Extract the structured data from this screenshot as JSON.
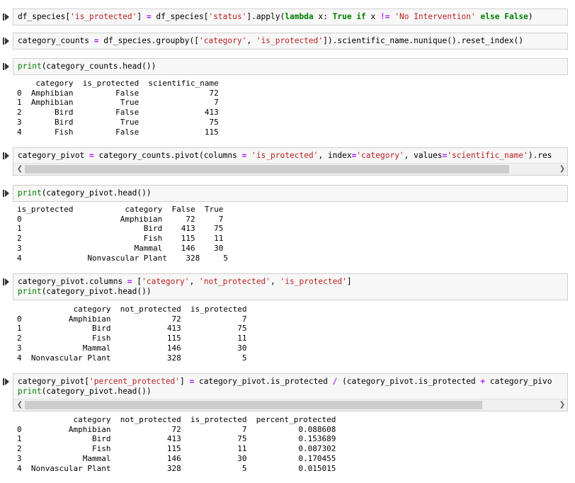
{
  "cells": [
    {
      "code": [
        [
          [
            "df_species[",
            ""
          ],
          [
            "'is_protected'",
            "str"
          ],
          [
            "] ",
            ""
          ],
          [
            "=",
            "op"
          ],
          [
            " df_species[",
            ""
          ],
          [
            "'status'",
            "str"
          ],
          [
            "].apply(",
            ""
          ],
          [
            "lambda",
            "kw"
          ],
          [
            " x: ",
            ""
          ],
          [
            "True",
            "kw"
          ],
          [
            " ",
            ""
          ],
          [
            "if",
            "kw"
          ],
          [
            " x ",
            ""
          ],
          [
            "!=",
            "op"
          ],
          [
            " ",
            ""
          ],
          [
            "'No Intervention'",
            "str"
          ],
          [
            " ",
            ""
          ],
          [
            "else",
            "kw"
          ],
          [
            " ",
            ""
          ],
          [
            "False",
            "kw"
          ],
          [
            ")",
            ""
          ]
        ]
      ]
    },
    {
      "code": [
        [
          [
            "category_counts ",
            ""
          ],
          [
            "=",
            "op"
          ],
          [
            " df_species.groupby([",
            ""
          ],
          [
            "'category'",
            "str"
          ],
          [
            ", ",
            ""
          ],
          [
            "'is_protected'",
            "str"
          ],
          [
            "]).scientific_name.nunique().reset_index()",
            ""
          ]
        ]
      ]
    },
    {
      "code": [
        [
          [
            "print",
            "fn"
          ],
          [
            "(category_counts.head())",
            ""
          ]
        ]
      ],
      "output": "    category  is_protected  scientific_name\n0  Amphibian         False               72\n1  Amphibian          True                7\n2       Bird         False              413\n3       Bird          True               75\n4       Fish         False              115"
    },
    {
      "code": [
        [
          [
            "category_pivot ",
            ""
          ],
          [
            "=",
            "op"
          ],
          [
            " category_counts.pivot(columns ",
            ""
          ],
          [
            "=",
            "op"
          ],
          [
            " ",
            ""
          ],
          [
            "'is_protected'",
            "str"
          ],
          [
            ", index",
            ""
          ],
          [
            "=",
            "op"
          ],
          [
            "",
            ""
          ],
          [
            "'category'",
            "str"
          ],
          [
            ", values",
            ""
          ],
          [
            "=",
            "op"
          ],
          [
            "",
            ""
          ],
          [
            "'scientific_name'",
            "str"
          ],
          [
            ").res",
            ""
          ]
        ]
      ],
      "scroll": {
        "left_arrow": "❮",
        "right_arrow": "❯"
      }
    },
    {
      "code": [
        [
          [
            "print",
            "fn"
          ],
          [
            "(category_pivot.head())",
            ""
          ]
        ]
      ],
      "output": "is_protected           category  False  True\n0                     Amphibian     72     7\n1                          Bird    413    75\n2                          Fish    115    11\n3                        Mammal    146    30\n4              Nonvascular Plant    328     5"
    },
    {
      "code": [
        [
          [
            "category_pivot.columns ",
            ""
          ],
          [
            "=",
            "op"
          ],
          [
            " [",
            ""
          ],
          [
            "'category'",
            "str"
          ],
          [
            ", ",
            ""
          ],
          [
            "'not_protected'",
            "str"
          ],
          [
            ", ",
            ""
          ],
          [
            "'is_protected'",
            "str"
          ],
          [
            "]",
            ""
          ]
        ],
        [
          [
            "print",
            "fn"
          ],
          [
            "(category_pivot.head())",
            ""
          ]
        ]
      ],
      "output": "            category  not_protected  is_protected\n0          Amphibian             72             7\n1               Bird            413            75\n2               Fish            115            11\n3             Mammal            146            30\n4  Nonvascular Plant            328             5"
    },
    {
      "code": [
        [
          [
            "category_pivot[",
            ""
          ],
          [
            "'percent_protected'",
            "str"
          ],
          [
            "] ",
            ""
          ],
          [
            "=",
            "op"
          ],
          [
            " category_pivot.is_protected ",
            ""
          ],
          [
            "/",
            "op"
          ],
          [
            " (category_pivot.is_protected ",
            ""
          ],
          [
            "+",
            "op"
          ],
          [
            " category_pivo",
            ""
          ]
        ],
        [
          [
            "print",
            "fn"
          ],
          [
            "(category_pivot.head())",
            ""
          ]
        ]
      ],
      "scroll": {
        "left_arrow": "❮",
        "right_arrow": "❯"
      },
      "output": "            category  not_protected  is_protected  percent_protected\n0          Amphibian             72             7           0.088608\n1               Bird            413            75           0.153689\n2               Fish            115            11           0.087302\n3             Mammal            146            30           0.170455\n4  Nonvascular Plant            328             5           0.015015"
    }
  ],
  "icons": {
    "run": "run-cell-icon"
  }
}
